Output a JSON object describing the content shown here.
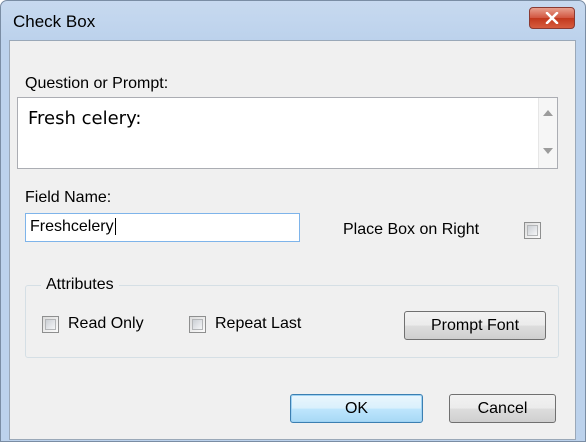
{
  "window": {
    "title": "Check Box",
    "close_icon": "close-x-icon"
  },
  "prompt": {
    "label": "Question or Prompt:",
    "value": "Fresh celery:"
  },
  "field": {
    "label": "Field Name:",
    "value": "Freshcelery"
  },
  "place_box_on_right": {
    "label": "Place Box on Right",
    "checked": false
  },
  "attributes": {
    "legend": "Attributes",
    "read_only": {
      "label": "Read Only",
      "checked": false
    },
    "repeat_last": {
      "label": "Repeat Last",
      "checked": false
    },
    "prompt_font_label": "Prompt Font"
  },
  "buttons": {
    "ok_label": "OK",
    "cancel_label": "Cancel"
  },
  "colors": {
    "client_bg": "#f0f0f0",
    "close_red": "#c2381d",
    "titlebar": "#bcd2ec",
    "focus_border": "#7eb4ea"
  }
}
